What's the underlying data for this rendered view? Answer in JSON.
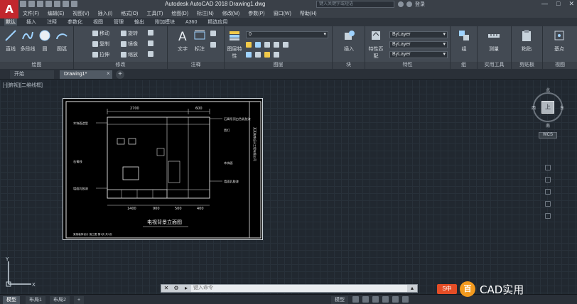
{
  "window": {
    "logo": "A",
    "title": "Autodesk AutoCAD 2018    Drawing1.dwg",
    "search_placeholder": "键入关键字或短语",
    "login": "登录",
    "min": "—",
    "max": "□",
    "close": "✕"
  },
  "menu": [
    "文件(F)",
    "编辑(E)",
    "视图(V)",
    "插入(I)",
    "格式(O)",
    "工具(T)",
    "绘图(D)",
    "标注(N)",
    "修改(M)",
    "参数(P)",
    "窗口(W)",
    "帮助(H)"
  ],
  "ribbon_tabs": [
    "默认",
    "插入",
    "注释",
    "参数化",
    "视图",
    "管理",
    "输出",
    "附加模块",
    "A360",
    "精选应用"
  ],
  "ribbon": {
    "draw": {
      "label": "绘图",
      "line": "直线",
      "polyline": "多段线",
      "circle": "圆",
      "arc": "圆弧"
    },
    "modify": {
      "label": "修改",
      "move": "移动",
      "rotate": "旋转",
      "copy": "复制",
      "mirror": "镜像",
      "stretch": "拉伸",
      "scale": "缩放"
    },
    "annotation": {
      "label": "注释",
      "text": "文字",
      "dimension": "标注"
    },
    "layers": {
      "label": "图层",
      "layer_props": "图层特性",
      "current_layer": "0"
    },
    "block": {
      "label": "块",
      "insert": "插入"
    },
    "properties": {
      "label": "特性",
      "match": "特性匹配",
      "color": "ByLayer",
      "linetype": "ByLayer",
      "lineweight": "ByLayer"
    },
    "groups": {
      "label": "组",
      "group": "组"
    },
    "utilities": {
      "label": "实用工具",
      "measure": "测量"
    },
    "clipboard": {
      "label": "剪贴板",
      "paste": "粘贴"
    },
    "view": {
      "label": "视图",
      "base": "基点"
    }
  },
  "file_tabs": {
    "start": "开始",
    "drawing": "Drawing1*",
    "close": "×",
    "add": "+"
  },
  "viewport": {
    "label": "[-][俯视][二维线框]"
  },
  "drawing": {
    "title": "电视背景立面图",
    "dims_top": [
      "2700",
      "600"
    ],
    "dims_bottom": [
      "1400",
      "900",
      "500",
      "400"
    ],
    "left_notes": [
      "木饰面造型",
      "石膏线",
      "墙面乳胶漆"
    ],
    "right_notes": [
      "石膏吊顶白色乳胶漆",
      "筒灯",
      "木饰面",
      "墙面乳胶漆"
    ],
    "side_text": "某某装饰设计工程有限公司",
    "bottom_text": "某某装饰设计 施工图 第1页 共1页"
  },
  "viewcube": {
    "top": "上",
    "north": "北",
    "south": "南",
    "west": "西",
    "east": "东",
    "wcs": "WCS"
  },
  "command": {
    "placeholder": "键入命令"
  },
  "status": {
    "model": "模型",
    "layout1": "布局1",
    "layout2": "布局2",
    "add": "+",
    "model_btn": "模型"
  },
  "watermark": {
    "s_label": "S中",
    "badge": "百",
    "text": "CAD实用"
  },
  "colors": {
    "background": "#212830",
    "ribbon": "#434a53",
    "logo": "#c2272d",
    "accent_orange": "#f39a1e"
  }
}
